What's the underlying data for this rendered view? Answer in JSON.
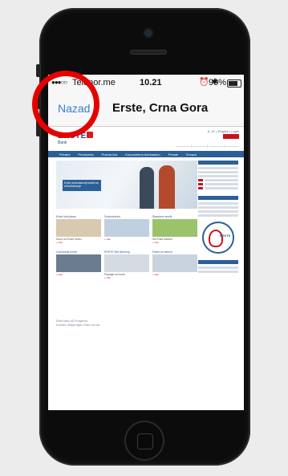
{
  "status_bar": {
    "signal": "●●●○○",
    "carrier": "Telenor.me",
    "time": "10.21",
    "icons": "⏰ ✱",
    "battery_percent": "90%",
    "battery_level": 0.9
  },
  "navbar": {
    "back_label": "Nazad",
    "title": "Erste, Crna Gora"
  },
  "website": {
    "logo": "ERSTE",
    "logo_sub": "Bank",
    "top_links": "A- A+ | English | Login",
    "menu": [
      "Privatni",
      "Preduzeća",
      "Pravna lica",
      "Korporativno bankarstvo",
      "Private",
      "Evropa"
    ],
    "hero_text": "Erste jednostavniji kredit za refinansiranje",
    "cards": [
      {
        "label": "Erste klub jasan",
        "text": "Novo na Erste klubu",
        "more": "» više"
      },
      {
        "label": "Svakodnevni",
        "text": "",
        "more": "» više"
      },
      {
        "label": "Stambeni kredit",
        "text": "Sa Erste kartom",
        "more": "» više"
      },
      {
        "label": "Gotovinski kredit",
        "text": "",
        "more": "» više"
      },
      {
        "label": "ERSTE Net Banking",
        "text": "Plaćajte od kuće",
        "more": "» više"
      },
      {
        "label": "Paket za tekuće",
        "text": "",
        "more": "» više"
      }
    ],
    "sidebar_badge": "ERSTE",
    "footer_lines": [
      "Erste bank AD Podgorica",
      "Kontakt | Mapa sajta | Kako do nas"
    ]
  }
}
